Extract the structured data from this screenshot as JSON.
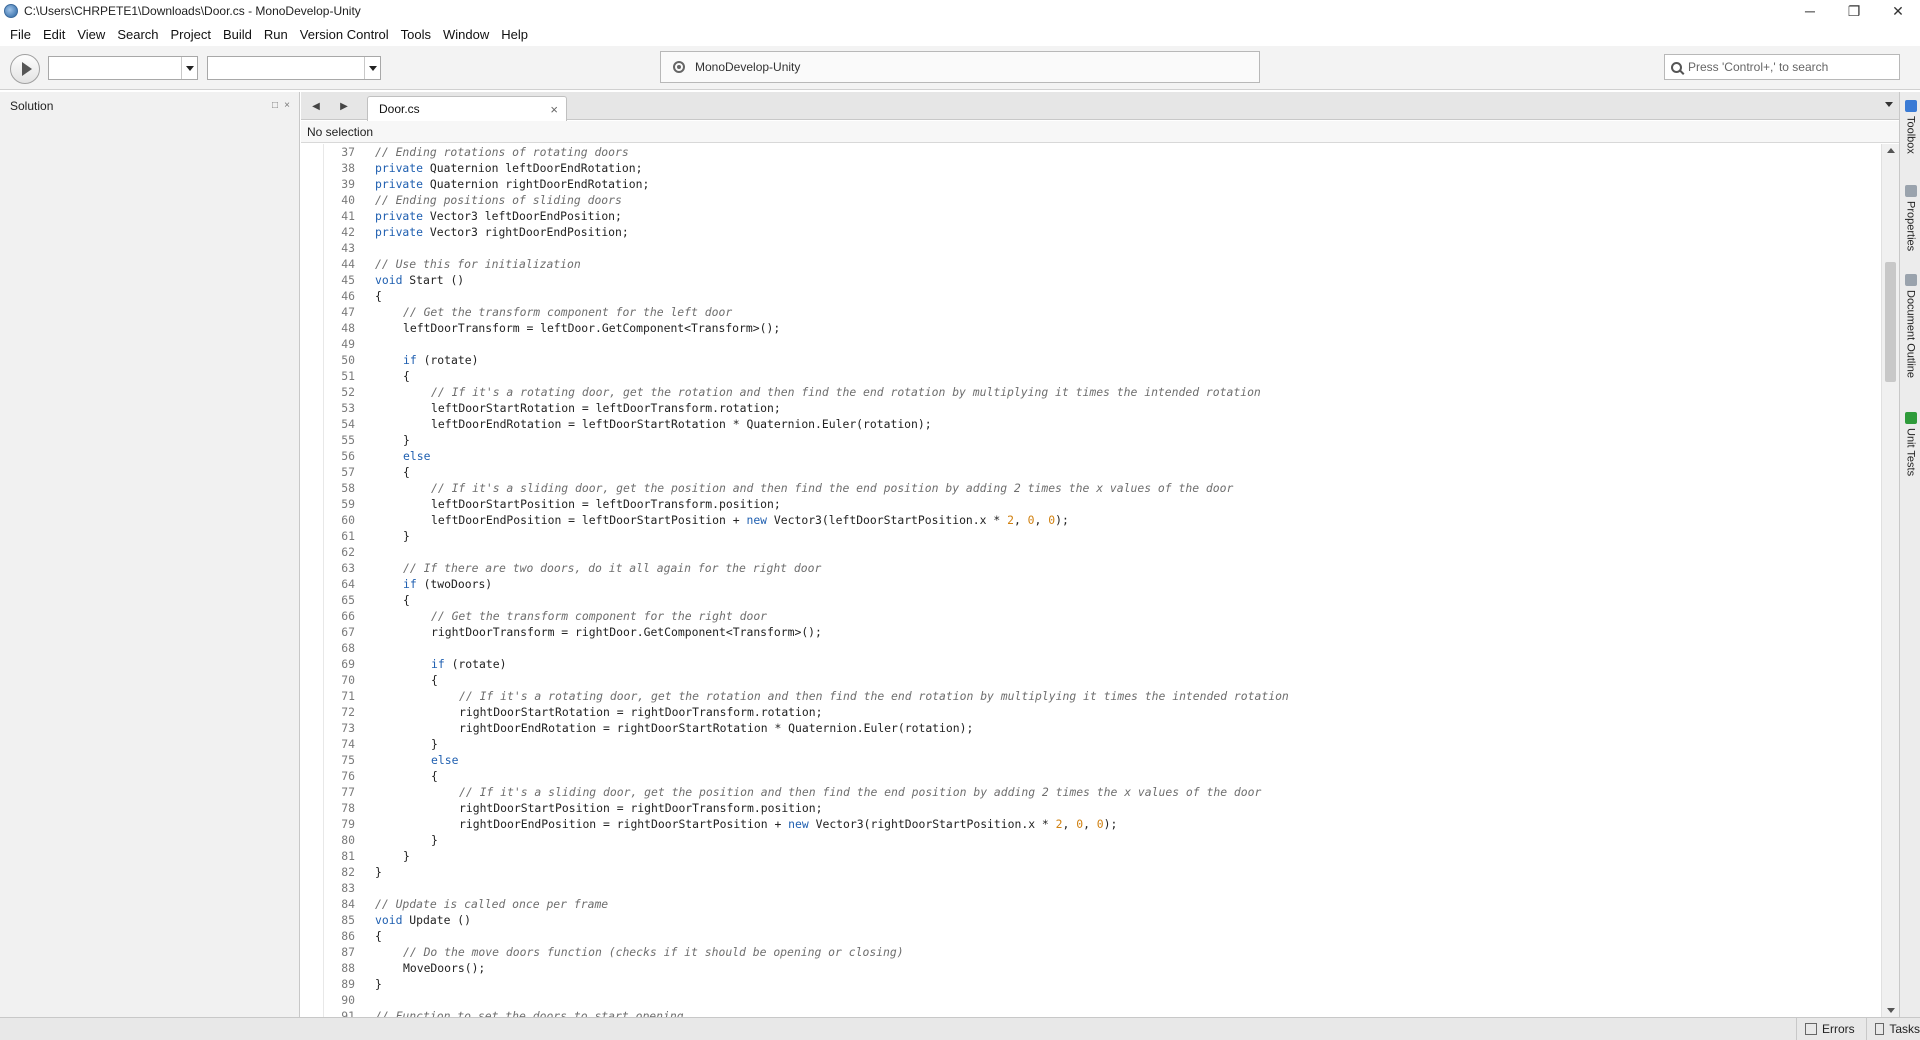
{
  "window": {
    "title": "C:\\Users\\CHRPETE1\\Downloads\\Door.cs - MonoDevelop-Unity",
    "minimize": "─",
    "restore": "❐",
    "close": "✕"
  },
  "menu": [
    "File",
    "Edit",
    "View",
    "Search",
    "Project",
    "Build",
    "Run",
    "Version Control",
    "Tools",
    "Window",
    "Help"
  ],
  "toolbar": {
    "config_value": "",
    "target_value": "",
    "status_text": "MonoDevelop-Unity",
    "search_placeholder": "Press 'Control+,' to search"
  },
  "solution_pad": {
    "title": "Solution",
    "restore_glyph": "□",
    "close_glyph": "×"
  },
  "editor": {
    "nav_back": "◀",
    "nav_forward": "▶",
    "tab_label": "Door.cs",
    "tab_close": "×",
    "path_text": "No selection",
    "lines": [
      {
        "n": "37",
        "indent": 0,
        "tokens": [
          {
            "t": "c",
            "v": "// Ending rotations of rotating doors"
          }
        ]
      },
      {
        "n": "38",
        "indent": 0,
        "tokens": [
          {
            "t": "k",
            "v": "private"
          },
          {
            "t": "p",
            "v": " Quaternion leftDoorEndRotation;"
          }
        ]
      },
      {
        "n": "39",
        "indent": 0,
        "tokens": [
          {
            "t": "k",
            "v": "private"
          },
          {
            "t": "p",
            "v": " Quaternion rightDoorEndRotation;"
          }
        ]
      },
      {
        "n": "40",
        "indent": 0,
        "tokens": [
          {
            "t": "c",
            "v": "// Ending positions of sliding doors"
          }
        ]
      },
      {
        "n": "41",
        "indent": 0,
        "tokens": [
          {
            "t": "k",
            "v": "private"
          },
          {
            "t": "p",
            "v": " Vector3 leftDoorEndPosition;"
          }
        ]
      },
      {
        "n": "42",
        "indent": 0,
        "tokens": [
          {
            "t": "k",
            "v": "private"
          },
          {
            "t": "p",
            "v": " Vector3 rightDoorEndPosition;"
          }
        ]
      },
      {
        "n": "43",
        "indent": 0,
        "tokens": []
      },
      {
        "n": "44",
        "indent": 0,
        "tokens": [
          {
            "t": "c",
            "v": "// Use this for initialization"
          }
        ]
      },
      {
        "n": "45",
        "indent": 0,
        "tokens": [
          {
            "t": "k",
            "v": "void"
          },
          {
            "t": "p",
            "v": " Start ()"
          }
        ]
      },
      {
        "n": "46",
        "indent": 0,
        "tokens": [
          {
            "t": "p",
            "v": "{"
          }
        ]
      },
      {
        "n": "47",
        "indent": 1,
        "tokens": [
          {
            "t": "c",
            "v": "// Get the transform component for the left door"
          }
        ]
      },
      {
        "n": "48",
        "indent": 1,
        "tokens": [
          {
            "t": "p",
            "v": "leftDoorTransform = leftDoor.GetComponent<Transform>();"
          }
        ]
      },
      {
        "n": "49",
        "indent": 0,
        "tokens": []
      },
      {
        "n": "50",
        "indent": 1,
        "tokens": [
          {
            "t": "k",
            "v": "if"
          },
          {
            "t": "p",
            "v": " (rotate)"
          }
        ]
      },
      {
        "n": "51",
        "indent": 1,
        "tokens": [
          {
            "t": "p",
            "v": "{"
          }
        ]
      },
      {
        "n": "52",
        "indent": 2,
        "tokens": [
          {
            "t": "c",
            "v": "// If it's a rotating door, get the rotation and then find the end rotation by multiplying it times the intended rotation"
          }
        ]
      },
      {
        "n": "53",
        "indent": 2,
        "tokens": [
          {
            "t": "p",
            "v": "leftDoorStartRotation = leftDoorTransform.rotation;"
          }
        ]
      },
      {
        "n": "54",
        "indent": 2,
        "tokens": [
          {
            "t": "p",
            "v": "leftDoorEndRotation = leftDoorStartRotation * Quaternion.Euler(rotation);"
          }
        ]
      },
      {
        "n": "55",
        "indent": 1,
        "tokens": [
          {
            "t": "p",
            "v": "}"
          }
        ]
      },
      {
        "n": "56",
        "indent": 1,
        "tokens": [
          {
            "t": "k",
            "v": "else"
          }
        ]
      },
      {
        "n": "57",
        "indent": 1,
        "tokens": [
          {
            "t": "p",
            "v": "{"
          }
        ]
      },
      {
        "n": "58",
        "indent": 2,
        "tokens": [
          {
            "t": "c",
            "v": "// If it's a sliding door, get the position and then find the end position by adding 2 times the x values of the door"
          }
        ]
      },
      {
        "n": "59",
        "indent": 2,
        "tokens": [
          {
            "t": "p",
            "v": "leftDoorStartPosition = leftDoorTransform.position;"
          }
        ]
      },
      {
        "n": "60",
        "indent": 2,
        "tokens": [
          {
            "t": "p",
            "v": "leftDoorEndPosition = leftDoorStartPosition + "
          },
          {
            "t": "k",
            "v": "new"
          },
          {
            "t": "p",
            "v": " Vector3(leftDoorStartPosition.x * "
          },
          {
            "t": "n",
            "v": "2"
          },
          {
            "t": "p",
            "v": ", "
          },
          {
            "t": "n",
            "v": "0"
          },
          {
            "t": "p",
            "v": ", "
          },
          {
            "t": "n",
            "v": "0"
          },
          {
            "t": "p",
            "v": ");"
          }
        ]
      },
      {
        "n": "61",
        "indent": 1,
        "tokens": [
          {
            "t": "p",
            "v": "}"
          }
        ]
      },
      {
        "n": "62",
        "indent": 0,
        "tokens": []
      },
      {
        "n": "63",
        "indent": 1,
        "tokens": [
          {
            "t": "c",
            "v": "// If there are two doors, do it all again for the right door"
          }
        ]
      },
      {
        "n": "64",
        "indent": 1,
        "tokens": [
          {
            "t": "k",
            "v": "if"
          },
          {
            "t": "p",
            "v": " (twoDoors)"
          }
        ]
      },
      {
        "n": "65",
        "indent": 1,
        "tokens": [
          {
            "t": "p",
            "v": "{"
          }
        ]
      },
      {
        "n": "66",
        "indent": 2,
        "tokens": [
          {
            "t": "c",
            "v": "// Get the transform component for the right door"
          }
        ]
      },
      {
        "n": "67",
        "indent": 2,
        "tokens": [
          {
            "t": "p",
            "v": "rightDoorTransform = rightDoor.GetComponent<Transform>();"
          }
        ]
      },
      {
        "n": "68",
        "indent": 0,
        "tokens": []
      },
      {
        "n": "69",
        "indent": 2,
        "tokens": [
          {
            "t": "k",
            "v": "if"
          },
          {
            "t": "p",
            "v": " (rotate)"
          }
        ]
      },
      {
        "n": "70",
        "indent": 2,
        "tokens": [
          {
            "t": "p",
            "v": "{"
          }
        ]
      },
      {
        "n": "71",
        "indent": 3,
        "tokens": [
          {
            "t": "c",
            "v": "// If it's a rotating door, get the rotation and then find the end rotation by multiplying it times the intended rotation"
          }
        ]
      },
      {
        "n": "72",
        "indent": 3,
        "tokens": [
          {
            "t": "p",
            "v": "rightDoorStartRotation = rightDoorTransform.rotation;"
          }
        ]
      },
      {
        "n": "73",
        "indent": 3,
        "tokens": [
          {
            "t": "p",
            "v": "rightDoorEndRotation = rightDoorStartRotation * Quaternion.Euler(rotation);"
          }
        ]
      },
      {
        "n": "74",
        "indent": 2,
        "tokens": [
          {
            "t": "p",
            "v": "}"
          }
        ]
      },
      {
        "n": "75",
        "indent": 2,
        "tokens": [
          {
            "t": "k",
            "v": "else"
          }
        ]
      },
      {
        "n": "76",
        "indent": 2,
        "tokens": [
          {
            "t": "p",
            "v": "{"
          }
        ]
      },
      {
        "n": "77",
        "indent": 3,
        "tokens": [
          {
            "t": "c",
            "v": "// If it's a sliding door, get the position and then find the end position by adding 2 times the x values of the door"
          }
        ]
      },
      {
        "n": "78",
        "indent": 3,
        "tokens": [
          {
            "t": "p",
            "v": "rightDoorStartPosition = rightDoorTransform.position;"
          }
        ]
      },
      {
        "n": "79",
        "indent": 3,
        "tokens": [
          {
            "t": "p",
            "v": "rightDoorEndPosition = rightDoorStartPosition + "
          },
          {
            "t": "k",
            "v": "new"
          },
          {
            "t": "p",
            "v": " Vector3(rightDoorStartPosition.x * "
          },
          {
            "t": "n",
            "v": "2"
          },
          {
            "t": "p",
            "v": ", "
          },
          {
            "t": "n",
            "v": "0"
          },
          {
            "t": "p",
            "v": ", "
          },
          {
            "t": "n",
            "v": "0"
          },
          {
            "t": "p",
            "v": ");"
          }
        ]
      },
      {
        "n": "80",
        "indent": 2,
        "tokens": [
          {
            "t": "p",
            "v": "}"
          }
        ]
      },
      {
        "n": "81",
        "indent": 1,
        "tokens": [
          {
            "t": "p",
            "v": "}"
          }
        ]
      },
      {
        "n": "82",
        "indent": 0,
        "tokens": [
          {
            "t": "p",
            "v": "}"
          }
        ]
      },
      {
        "n": "83",
        "indent": 0,
        "tokens": []
      },
      {
        "n": "84",
        "indent": 0,
        "tokens": [
          {
            "t": "c",
            "v": "// Update is called once per frame"
          }
        ]
      },
      {
        "n": "85",
        "indent": 0,
        "tokens": [
          {
            "t": "k",
            "v": "void"
          },
          {
            "t": "p",
            "v": " Update ()"
          }
        ]
      },
      {
        "n": "86",
        "indent": 0,
        "tokens": [
          {
            "t": "p",
            "v": "{"
          }
        ]
      },
      {
        "n": "87",
        "indent": 1,
        "tokens": [
          {
            "t": "c",
            "v": "// Do the move doors function (checks if it should be opening or closing)"
          }
        ]
      },
      {
        "n": "88",
        "indent": 1,
        "tokens": [
          {
            "t": "p",
            "v": "MoveDoors();"
          }
        ]
      },
      {
        "n": "89",
        "indent": 0,
        "tokens": [
          {
            "t": "p",
            "v": "}"
          }
        ]
      },
      {
        "n": "90",
        "indent": 0,
        "tokens": []
      },
      {
        "n": "91",
        "indent": 0,
        "tokens": [
          {
            "t": "c",
            "v": "// Function to set the doors to start opening"
          }
        ]
      }
    ]
  },
  "right_dock": [
    {
      "label": "Toolbox",
      "icon": "toolbox-icon",
      "color": "#3a7bd5"
    },
    {
      "label": "Properties",
      "icon": "properties-icon",
      "color": "#9aa3ad"
    },
    {
      "label": "Document Outline",
      "icon": "outline-icon",
      "color": "#9aa3ad"
    },
    {
      "label": "Unit Tests",
      "icon": "unit-tests-icon",
      "color": "#2e9b3a"
    }
  ],
  "statusbar": {
    "errors_label": "Errors",
    "tasks_label": "Tasks"
  },
  "colors": {
    "keyword": "#1f5fb0",
    "comment": "#6e6e6e",
    "number": "#d08010"
  }
}
